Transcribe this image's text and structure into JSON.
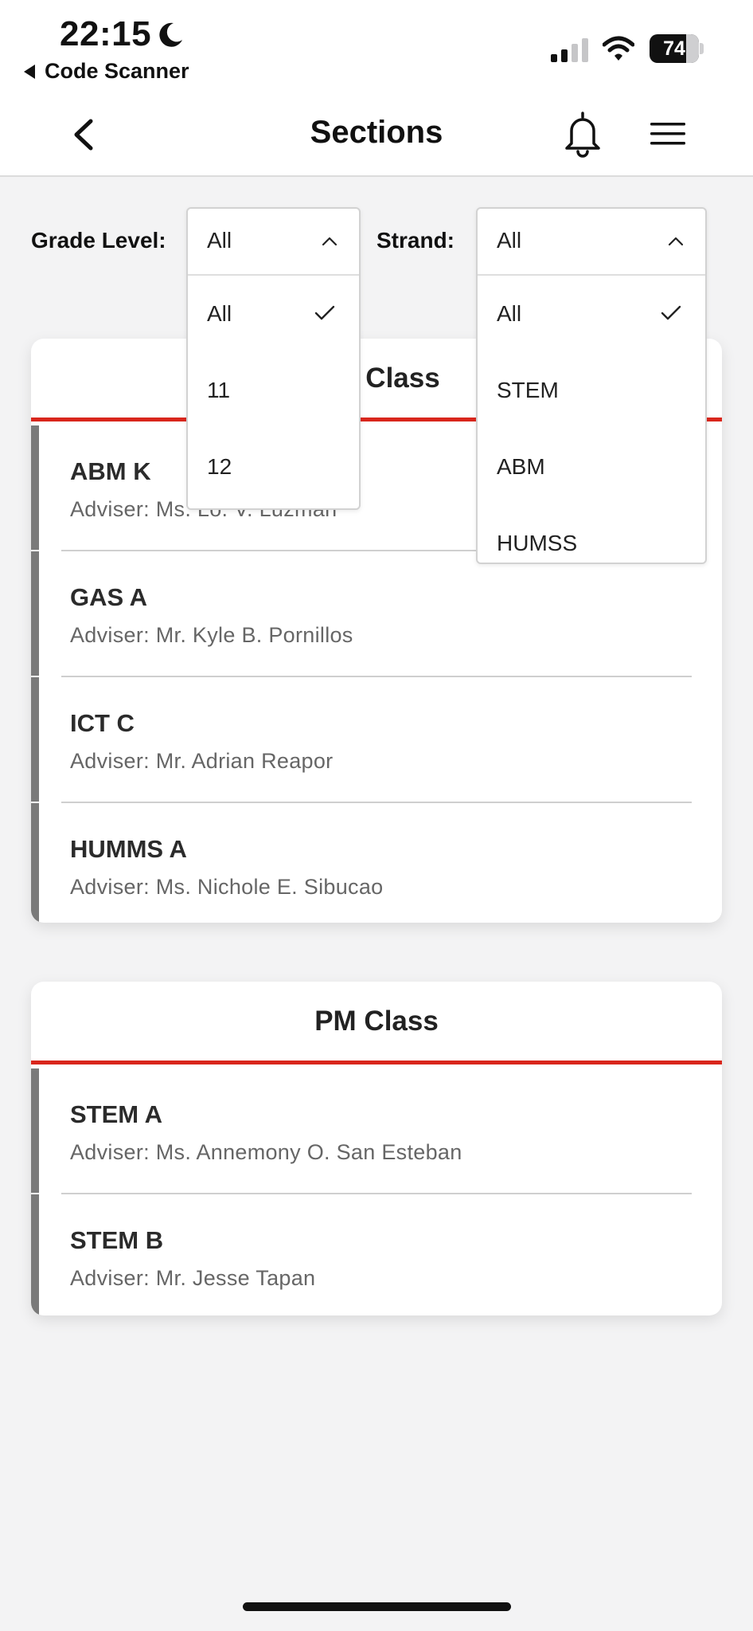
{
  "status_bar": {
    "time": "22:15",
    "back_app": "Code Scanner",
    "battery": "74"
  },
  "nav": {
    "title": "Sections"
  },
  "filters": {
    "grade": {
      "label": "Grade Level:",
      "selected": "All",
      "options": [
        "All",
        "11",
        "12"
      ]
    },
    "strand": {
      "label": "Strand:",
      "selected": "All",
      "options": [
        "All",
        "STEM",
        "ABM",
        "HUMSS"
      ]
    }
  },
  "am_class": {
    "title": "AM Class",
    "title_visible": "Class",
    "sections": [
      {
        "name": "ABM K",
        "adviser": "Adviser: Ms. Lo. V. Luzman"
      },
      {
        "name": "GAS A",
        "adviser": "Adviser: Mr. Kyle B. Pornillos"
      },
      {
        "name": "ICT C",
        "adviser": "Adviser: Mr. Adrian Reapor"
      },
      {
        "name": "HUMMS A",
        "adviser": "Adviser: Ms. Nichole E. Sibucao"
      }
    ]
  },
  "pm_class": {
    "title": "PM Class",
    "sections": [
      {
        "name": "STEM A",
        "adviser": "Adviser: Ms. Annemony O. San Esteban"
      },
      {
        "name": "STEM B",
        "adviser": "Adviser: Mr. Jesse Tapan"
      }
    ]
  },
  "colors": {
    "accent_red": "#d9261c",
    "row_bar": "#7a7a7a",
    "background": "#f3f3f4"
  }
}
